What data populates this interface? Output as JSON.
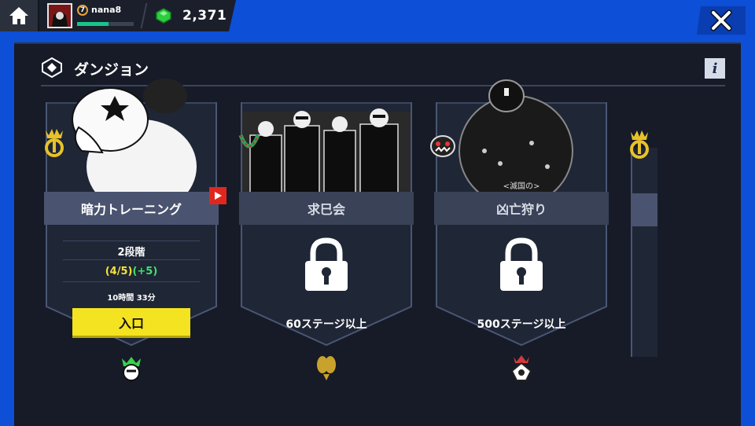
{
  "header": {
    "username": "nana8",
    "level": "7",
    "xp_progress": 0.55,
    "gems": "2,371"
  },
  "panel": {
    "title": "ダンジョン"
  },
  "cards": [
    {
      "title": "暗力トレーニング",
      "stage": "2段階",
      "progress": "(4/5)",
      "bonus": "(+5)",
      "timer": "10時間 33分",
      "enter_label": "入口"
    },
    {
      "title": "求巳会",
      "requirement": "60ステージ以上"
    },
    {
      "title": "凶亡狩り",
      "art_caption": "<滅国の>",
      "requirement": "500ステージ以上"
    }
  ],
  "colors": {
    "frame_blue": "#0d4fd6",
    "panel_bg": "#161b27",
    "enter_yellow": "#f4e320",
    "progress_yellow": "#f5e23a",
    "bonus_green": "#42e06a",
    "gem_green": "#2ecc40"
  },
  "icons": [
    "home-icon",
    "avatar",
    "gem-icon",
    "close-icon",
    "dungeon-icon",
    "info-icon",
    "lock-icon",
    "video-icon",
    "crown-emblem-icon",
    "faction-icon"
  ]
}
